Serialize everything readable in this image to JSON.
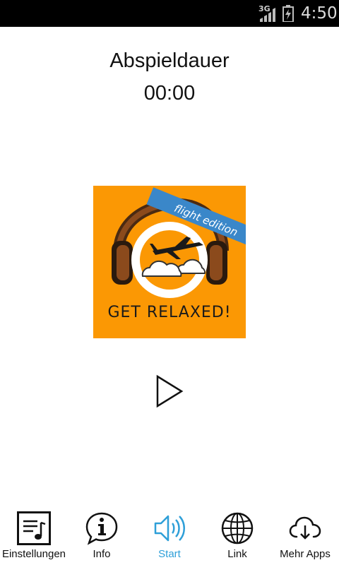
{
  "status_bar": {
    "network": "3G",
    "time": "4:50"
  },
  "player": {
    "title": "Abspieldauer",
    "duration": "00:00",
    "cover": {
      "banner_text": "flight edition",
      "caption": "GET RELAXED!"
    }
  },
  "bottom_nav": {
    "items": [
      {
        "label": "Einstellungen",
        "icon": "playlist-icon"
      },
      {
        "label": "Info",
        "icon": "info-icon"
      },
      {
        "label": "Start",
        "icon": "speaker-icon",
        "active": true
      },
      {
        "label": "Link",
        "icon": "globe-icon"
      },
      {
        "label": "Mehr Apps",
        "icon": "cloud-download-icon"
      }
    ]
  },
  "colors": {
    "accent": "#2e9fd8",
    "cover_bg": "#fb9804",
    "banner": "#3a87c9"
  }
}
